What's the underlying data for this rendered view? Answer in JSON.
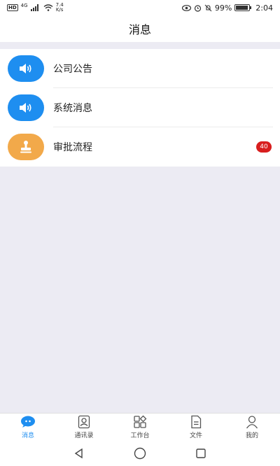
{
  "status_bar": {
    "network_rate": "7.4",
    "network_unit": "K/s",
    "hd_label": "HD",
    "signal_label": "4G",
    "battery_percent": "99%",
    "time": "2:04"
  },
  "header": {
    "title": "消息"
  },
  "messages": [
    {
      "label": "公司公告",
      "icon": "speaker-icon",
      "color": "#1e8ef0",
      "badge": ""
    },
    {
      "label": "系统消息",
      "icon": "speaker-icon",
      "color": "#1e8ef0",
      "badge": ""
    },
    {
      "label": "审批流程",
      "icon": "stamp-icon",
      "color": "#f2a94a",
      "badge": "40"
    }
  ],
  "tabs": [
    {
      "label": "消息",
      "icon": "chat-bubble-icon",
      "active": true
    },
    {
      "label": "通讯录",
      "icon": "contacts-icon",
      "active": false
    },
    {
      "label": "工作台",
      "icon": "workbench-icon",
      "active": false
    },
    {
      "label": "文件",
      "icon": "file-icon",
      "active": false
    },
    {
      "label": "我的",
      "icon": "person-icon",
      "active": false
    }
  ],
  "colors": {
    "accent": "#1e8ef0",
    "badge": "#d81e1e",
    "background": "#ecebf3"
  }
}
